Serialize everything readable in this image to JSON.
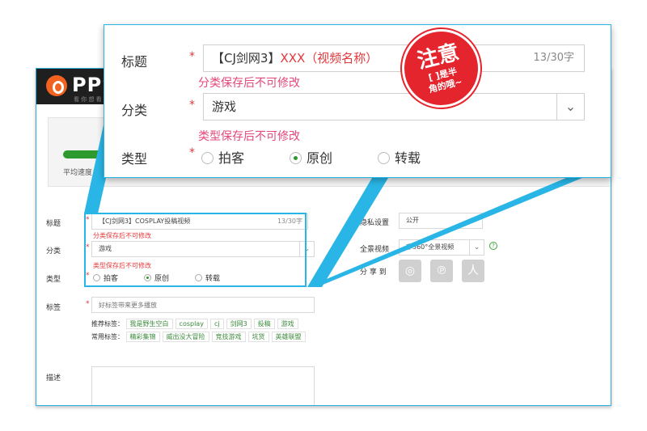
{
  "header": {
    "logo_text": "PPS",
    "logo_sub": "看 你 想 看"
  },
  "upload": {
    "speed_label": "平均速度：3.2",
    "progress_fraction": 0.4
  },
  "form": {
    "title": {
      "label": "标题",
      "required": "*",
      "value": "【CJ剑网3】COSPLAY投稿视频",
      "counter": "13/30字",
      "hint": "分类保存后不可修改"
    },
    "category": {
      "label": "分类",
      "required": "*",
      "value": "游戏",
      "arrow": "⌄",
      "hint": "类型保存后不可修改"
    },
    "type": {
      "label": "类型",
      "required": "*",
      "options": [
        "拍客",
        "原创",
        "转载"
      ],
      "selected": "原创"
    },
    "tags": {
      "label": "标签",
      "required": "*",
      "placeholder": "好标签带来更多播放",
      "recommended_label": "推荐标签：",
      "recommended": [
        "我是野生空白",
        "cosplay",
        "cj",
        "剑网3",
        "投稿",
        "游戏"
      ],
      "common_label": "常用标签：",
      "common": [
        "精彩集锦",
        "威出没大冒险",
        "竞技游戏",
        "坑货",
        "英雄联盟"
      ]
    },
    "desc": {
      "label": "描述"
    },
    "privacy": {
      "label": "隐私设置",
      "value": "公开"
    },
    "panorama": {
      "label": "全景视频",
      "value": "非360°全景视频",
      "help": "?"
    },
    "share": {
      "label": "分 享 到"
    }
  },
  "zoom": {
    "title_label": "标题",
    "required": "*",
    "title_prefix": "【CJ剑网3】",
    "title_placeholder": "XXX（视频名称）",
    "title_counter": "13/30字",
    "title_hint": "分类保存后不可修改",
    "category_label": "分类",
    "category_value": "游戏",
    "category_hint": "类型保存后不可修改",
    "type_label": "类型",
    "type_options": [
      "拍客",
      "原创",
      "转载"
    ],
    "type_selected": "原创"
  },
  "stamp": {
    "big": "注意",
    "small_line1": "[ ]是半",
    "small_line2": "角的哦~"
  },
  "colors": {
    "accent": "#29b6e6",
    "brand": "#f4621f",
    "alert": "#e5252d",
    "progress": "#2d9a2d"
  }
}
